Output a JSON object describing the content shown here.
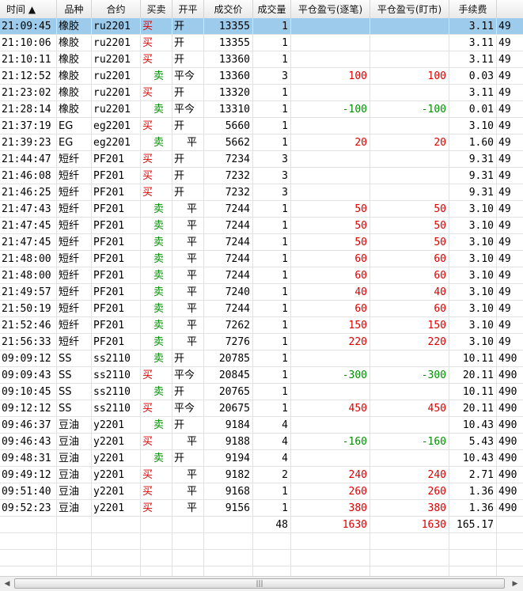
{
  "columns": [
    {
      "label": "时间 ▲",
      "key": "time"
    },
    {
      "label": "品种",
      "key": "variety"
    },
    {
      "label": "合约",
      "key": "contract"
    },
    {
      "label": "买卖",
      "key": "side"
    },
    {
      "label": "开平",
      "key": "oc"
    },
    {
      "label": "成交价",
      "key": "price"
    },
    {
      "label": "成交量",
      "key": "qty"
    },
    {
      "label": "平仓盈亏(逐笔)",
      "key": "pnl_trade"
    },
    {
      "label": "平仓盈亏(盯市)",
      "key": "pnl_mtm"
    },
    {
      "label": "手续费",
      "key": "fee"
    },
    {
      "label": "",
      "key": "extra"
    }
  ],
  "rows": [
    {
      "time": "21:09:45",
      "variety": "橡胶",
      "contract": "ru2201",
      "side": "买",
      "oc": "开",
      "price": "13355",
      "qty": "1",
      "pnl_trade": "",
      "pnl_mtm": "",
      "fee": "3.11",
      "extra": "49",
      "selected": true
    },
    {
      "time": "21:10:06",
      "variety": "橡胶",
      "contract": "ru2201",
      "side": "买",
      "oc": "开",
      "price": "13355",
      "qty": "1",
      "pnl_trade": "",
      "pnl_mtm": "",
      "fee": "3.11",
      "extra": "49"
    },
    {
      "time": "21:10:11",
      "variety": "橡胶",
      "contract": "ru2201",
      "side": "买",
      "oc": "开",
      "price": "13360",
      "qty": "1",
      "pnl_trade": "",
      "pnl_mtm": "",
      "fee": "3.11",
      "extra": "49"
    },
    {
      "time": "21:12:52",
      "variety": "橡胶",
      "contract": "ru2201",
      "side": "卖",
      "oc": "平今",
      "price": "13360",
      "qty": "3",
      "pnl_trade": "100",
      "pnl_mtm": "100",
      "fee": "0.03",
      "extra": "49"
    },
    {
      "time": "21:23:02",
      "variety": "橡胶",
      "contract": "ru2201",
      "side": "买",
      "oc": "开",
      "price": "13320",
      "qty": "1",
      "pnl_trade": "",
      "pnl_mtm": "",
      "fee": "3.11",
      "extra": "49"
    },
    {
      "time": "21:28:14",
      "variety": "橡胶",
      "contract": "ru2201",
      "side": "卖",
      "oc": "平今",
      "price": "13310",
      "qty": "1",
      "pnl_trade": "-100",
      "pnl_mtm": "-100",
      "fee": "0.01",
      "extra": "49"
    },
    {
      "time": "21:37:19",
      "variety": "EG",
      "contract": "eg2201",
      "side": "买",
      "oc": "开",
      "price": "5660",
      "qty": "1",
      "pnl_trade": "",
      "pnl_mtm": "",
      "fee": "3.10",
      "extra": "49"
    },
    {
      "time": "21:39:23",
      "variety": "EG",
      "contract": "eg2201",
      "side": "卖",
      "oc": "平",
      "price": "5662",
      "qty": "1",
      "pnl_trade": "20",
      "pnl_mtm": "20",
      "fee": "1.60",
      "extra": "49"
    },
    {
      "time": "21:44:47",
      "variety": "短纤",
      "contract": "PF201",
      "side": "买",
      "oc": "开",
      "price": "7234",
      "qty": "3",
      "pnl_trade": "",
      "pnl_mtm": "",
      "fee": "9.31",
      "extra": "49"
    },
    {
      "time": "21:46:08",
      "variety": "短纤",
      "contract": "PF201",
      "side": "买",
      "oc": "开",
      "price": "7232",
      "qty": "3",
      "pnl_trade": "",
      "pnl_mtm": "",
      "fee": "9.31",
      "extra": "49"
    },
    {
      "time": "21:46:25",
      "variety": "短纤",
      "contract": "PF201",
      "side": "买",
      "oc": "开",
      "price": "7232",
      "qty": "3",
      "pnl_trade": "",
      "pnl_mtm": "",
      "fee": "9.31",
      "extra": "49"
    },
    {
      "time": "21:47:43",
      "variety": "短纤",
      "contract": "PF201",
      "side": "卖",
      "oc": "平",
      "price": "7244",
      "qty": "1",
      "pnl_trade": "50",
      "pnl_mtm": "50",
      "fee": "3.10",
      "extra": "49"
    },
    {
      "time": "21:47:45",
      "variety": "短纤",
      "contract": "PF201",
      "side": "卖",
      "oc": "平",
      "price": "7244",
      "qty": "1",
      "pnl_trade": "50",
      "pnl_mtm": "50",
      "fee": "3.10",
      "extra": "49"
    },
    {
      "time": "21:47:45",
      "variety": "短纤",
      "contract": "PF201",
      "side": "卖",
      "oc": "平",
      "price": "7244",
      "qty": "1",
      "pnl_trade": "50",
      "pnl_mtm": "50",
      "fee": "3.10",
      "extra": "49"
    },
    {
      "time": "21:48:00",
      "variety": "短纤",
      "contract": "PF201",
      "side": "卖",
      "oc": "平",
      "price": "7244",
      "qty": "1",
      "pnl_trade": "60",
      "pnl_mtm": "60",
      "fee": "3.10",
      "extra": "49"
    },
    {
      "time": "21:48:00",
      "variety": "短纤",
      "contract": "PF201",
      "side": "卖",
      "oc": "平",
      "price": "7244",
      "qty": "1",
      "pnl_trade": "60",
      "pnl_mtm": "60",
      "fee": "3.10",
      "extra": "49"
    },
    {
      "time": "21:49:57",
      "variety": "短纤",
      "contract": "PF201",
      "side": "卖",
      "oc": "平",
      "price": "7240",
      "qty": "1",
      "pnl_trade": "40",
      "pnl_mtm": "40",
      "fee": "3.10",
      "extra": "49"
    },
    {
      "time": "21:50:19",
      "variety": "短纤",
      "contract": "PF201",
      "side": "卖",
      "oc": "平",
      "price": "7244",
      "qty": "1",
      "pnl_trade": "60",
      "pnl_mtm": "60",
      "fee": "3.10",
      "extra": "49"
    },
    {
      "time": "21:52:46",
      "variety": "短纤",
      "contract": "PF201",
      "side": "卖",
      "oc": "平",
      "price": "7262",
      "qty": "1",
      "pnl_trade": "150",
      "pnl_mtm": "150",
      "fee": "3.10",
      "extra": "49"
    },
    {
      "time": "21:56:33",
      "variety": "短纤",
      "contract": "PF201",
      "side": "卖",
      "oc": "平",
      "price": "7276",
      "qty": "1",
      "pnl_trade": "220",
      "pnl_mtm": "220",
      "fee": "3.10",
      "extra": "49"
    },
    {
      "time": "09:09:12",
      "variety": "SS",
      "contract": "ss2110",
      "side": "卖",
      "oc": "开",
      "price": "20785",
      "qty": "1",
      "pnl_trade": "",
      "pnl_mtm": "",
      "fee": "10.11",
      "extra": "490"
    },
    {
      "time": "09:09:43",
      "variety": "SS",
      "contract": "ss2110",
      "side": "买",
      "oc": "平今",
      "price": "20845",
      "qty": "1",
      "pnl_trade": "-300",
      "pnl_mtm": "-300",
      "fee": "20.11",
      "extra": "490"
    },
    {
      "time": "09:10:45",
      "variety": "SS",
      "contract": "ss2110",
      "side": "卖",
      "oc": "开",
      "price": "20765",
      "qty": "1",
      "pnl_trade": "",
      "pnl_mtm": "",
      "fee": "10.11",
      "extra": "490"
    },
    {
      "time": "09:12:12",
      "variety": "SS",
      "contract": "ss2110",
      "side": "买",
      "oc": "平今",
      "price": "20675",
      "qty": "1",
      "pnl_trade": "450",
      "pnl_mtm": "450",
      "fee": "20.11",
      "extra": "490"
    },
    {
      "time": "09:46:37",
      "variety": "豆油",
      "contract": "y2201",
      "side": "卖",
      "oc": "开",
      "price": "9184",
      "qty": "4",
      "pnl_trade": "",
      "pnl_mtm": "",
      "fee": "10.43",
      "extra": "490"
    },
    {
      "time": "09:46:43",
      "variety": "豆油",
      "contract": "y2201",
      "side": "买",
      "oc": "平",
      "price": "9188",
      "qty": "4",
      "pnl_trade": "-160",
      "pnl_mtm": "-160",
      "fee": "5.43",
      "extra": "490"
    },
    {
      "time": "09:48:31",
      "variety": "豆油",
      "contract": "y2201",
      "side": "卖",
      "oc": "开",
      "price": "9194",
      "qty": "4",
      "pnl_trade": "",
      "pnl_mtm": "",
      "fee": "10.43",
      "extra": "490"
    },
    {
      "time": "09:49:12",
      "variety": "豆油",
      "contract": "y2201",
      "side": "买",
      "oc": "平",
      "price": "9182",
      "qty": "2",
      "pnl_trade": "240",
      "pnl_mtm": "240",
      "fee": "2.71",
      "extra": "490"
    },
    {
      "time": "09:51:40",
      "variety": "豆油",
      "contract": "y2201",
      "side": "买",
      "oc": "平",
      "price": "9168",
      "qty": "1",
      "pnl_trade": "260",
      "pnl_mtm": "260",
      "fee": "1.36",
      "extra": "490"
    },
    {
      "time": "09:52:23",
      "variety": "豆油",
      "contract": "y2201",
      "side": "买",
      "oc": "平",
      "price": "9156",
      "qty": "1",
      "pnl_trade": "380",
      "pnl_mtm": "380",
      "fee": "1.36",
      "extra": "490"
    }
  ],
  "totals": {
    "qty": "48",
    "pnl_trade": "1630",
    "pnl_mtm": "1630",
    "fee": "165.17"
  },
  "scrollbar": {
    "left_arrow": "◀",
    "right_arrow": "▶",
    "grip": "|||"
  },
  "colors": {
    "selected_row": "#9ccbeb",
    "buy": "#e00000",
    "sell": "#009000",
    "profit": "#e00000",
    "loss": "#009000"
  }
}
